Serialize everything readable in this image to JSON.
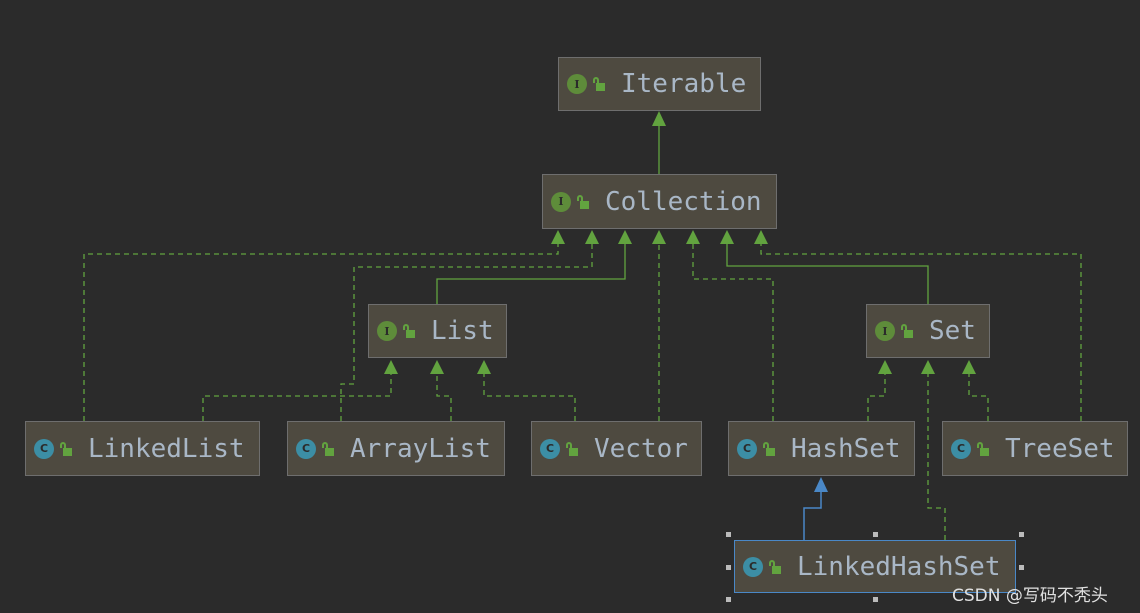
{
  "colors": {
    "background": "#2b2b2b",
    "node_fill": "#4e4a40",
    "interface_badge": "#5e8c3a",
    "class_badge": "#3c8ea5",
    "edge": "#62a33f",
    "selected_edge": "#4a88c7",
    "label": "#a9b7c6"
  },
  "nodes": {
    "iterable": {
      "label": "Iterable",
      "kind": "I",
      "type": "interface"
    },
    "collection": {
      "label": "Collection",
      "kind": "I",
      "type": "interface"
    },
    "list": {
      "label": "List",
      "kind": "I",
      "type": "interface"
    },
    "set": {
      "label": "Set",
      "kind": "I",
      "type": "interface"
    },
    "linkedlist": {
      "label": "LinkedList",
      "kind": "C",
      "type": "class"
    },
    "arraylist": {
      "label": "ArrayList",
      "kind": "C",
      "type": "class"
    },
    "vector": {
      "label": "Vector",
      "kind": "C",
      "type": "class"
    },
    "hashset": {
      "label": "HashSet",
      "kind": "C",
      "type": "class"
    },
    "treeset": {
      "label": "TreeSet",
      "kind": "C",
      "type": "class"
    },
    "linkedhashset": {
      "label": "LinkedHashSet",
      "kind": "C",
      "type": "class",
      "selected": true
    }
  },
  "relations": [
    {
      "from": "Collection",
      "to": "Iterable",
      "type": "extends"
    },
    {
      "from": "List",
      "to": "Collection",
      "type": "extends"
    },
    {
      "from": "Set",
      "to": "Collection",
      "type": "extends"
    },
    {
      "from": "LinkedList",
      "to": "Collection",
      "type": "implements"
    },
    {
      "from": "ArrayList",
      "to": "Collection",
      "type": "implements"
    },
    {
      "from": "Vector",
      "to": "Collection",
      "type": "implements"
    },
    {
      "from": "HashSet",
      "to": "Collection",
      "type": "implements"
    },
    {
      "from": "TreeSet",
      "to": "Collection",
      "type": "implements"
    },
    {
      "from": "LinkedList",
      "to": "List",
      "type": "implements"
    },
    {
      "from": "ArrayList",
      "to": "List",
      "type": "implements"
    },
    {
      "from": "Vector",
      "to": "List",
      "type": "implements"
    },
    {
      "from": "HashSet",
      "to": "Set",
      "type": "implements"
    },
    {
      "from": "TreeSet",
      "to": "Set",
      "type": "implements"
    },
    {
      "from": "LinkedHashSet",
      "to": "Set",
      "type": "implements"
    },
    {
      "from": "LinkedHashSet",
      "to": "HashSet",
      "type": "extends"
    }
  ],
  "watermark": "CSDN @写码不秃头"
}
